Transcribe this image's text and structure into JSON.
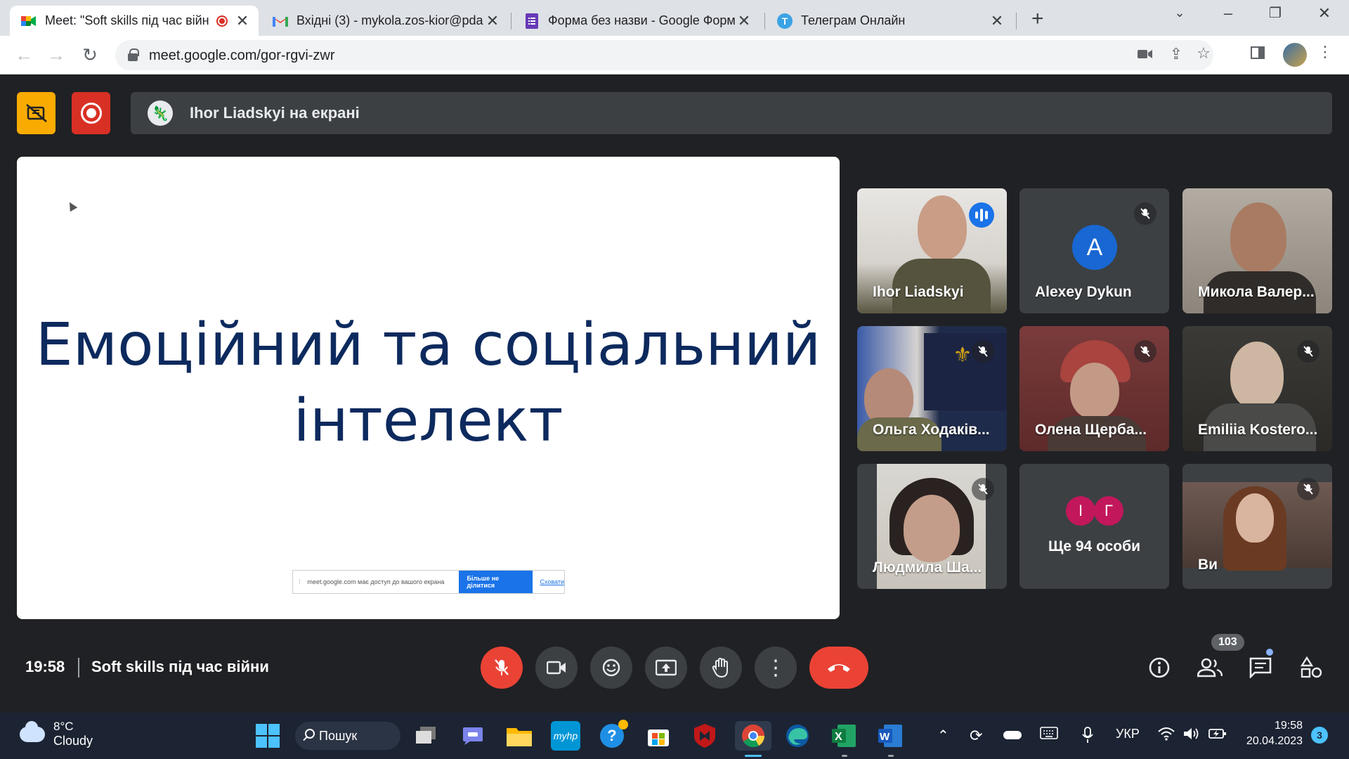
{
  "browser": {
    "tabs": [
      {
        "title": "Meet: \"Soft skills під час війн",
        "favicon": "google-meet-icon",
        "active": true,
        "recording": true
      },
      {
        "title": "Вхідні (3) - mykola.zos-kior@pda",
        "favicon": "gmail-icon",
        "active": false
      },
      {
        "title": "Форма без назви - Google Форм",
        "favicon": "google-forms-icon",
        "active": false
      },
      {
        "title": "Телеграм Онлайн",
        "favicon": "telegram-icon",
        "active": false
      }
    ],
    "url": "meet.google.com/gor-rgvi-zwr",
    "close_glyph": "✕",
    "new_tab_glyph": "+"
  },
  "meet": {
    "presenter_banner": "Ihor Liadskyi на екрані",
    "slide": {
      "title_line1": "Емоційний та соціальний",
      "title_line2": "інтелект",
      "share_notice": "meet.google.com має доступ до вашого екрана",
      "stop_share": "Більше не ділитися",
      "hide": "Сховати"
    },
    "participants": [
      {
        "name": "Ihor Liadskyi",
        "speaking": true,
        "muted": false
      },
      {
        "name": "Alexey Dykun",
        "initial": "A",
        "muted": true
      },
      {
        "name": "Микола Валер...",
        "muted": false
      },
      {
        "name": "Ольга Ходаків...",
        "muted": true
      },
      {
        "name": "Олена Щерба...",
        "muted": true
      },
      {
        "name": "Emiliia Kostero...",
        "muted": true
      },
      {
        "name": "Людмила Ша...",
        "muted": true
      },
      {
        "name": "Ще 94 особи",
        "initials": [
          "І",
          "Г"
        ]
      },
      {
        "name": "Ви",
        "muted": true
      }
    ],
    "time": "19:58",
    "meeting_title": "Soft skills під час війни",
    "people_count": "103",
    "colors": {
      "end_call": "#ea4335",
      "accent": "#1a73e8",
      "record": "#d93025",
      "warning": "#f9ab00"
    }
  },
  "taskbar": {
    "temperature": "8°C",
    "weather": "Cloudy",
    "search_label": "Пошук",
    "language": "УКР",
    "clock_time": "19:58",
    "clock_date": "20.04.2023",
    "notifications": "3"
  }
}
